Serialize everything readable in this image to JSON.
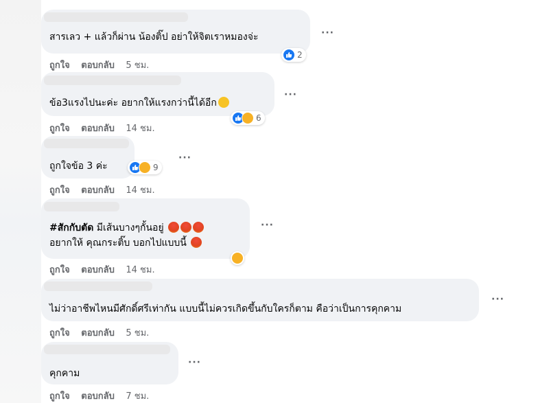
{
  "action_labels": {
    "like": "ถูกใจ",
    "reply": "ตอบกลับ"
  },
  "more_label": "···",
  "comments": [
    {
      "text": "สารเลว + แล้วก็ผ่าน น้องติ๊ป อย่าให้จิตเราหมองจ่ะ",
      "time": "5 ชม.",
      "reaction_count": "2"
    },
    {
      "text": "ข้อ3แรงไปนะค่ะ อยากให้แรงกว่านี้ได้อีก",
      "time": "14 ชม.",
      "reaction_count": "6"
    },
    {
      "text": "ถูกใจข้อ 3 ค่ะ",
      "time": "14 ชม.",
      "reaction_count": "9"
    },
    {
      "hashtag": "#สักกับตัด",
      "text_line1": " มีเส้นบางๆกั้นอยู่",
      "text_line2": "อยากให้ คุณกระติ๊บ บอกไปแบบนี้",
      "time": "14 ชม."
    },
    {
      "text": "ไม่ว่าอาชีพไหนมีศักดิ์ศรีเท่ากัน แบบนี้ไม่ควรเกิดขึ้นกับใครก็ตาม คือว่าเป็นการคุกคาม",
      "time": "5 ชม."
    },
    {
      "text": "คุกคาม",
      "time": "7 ชม."
    }
  ]
}
